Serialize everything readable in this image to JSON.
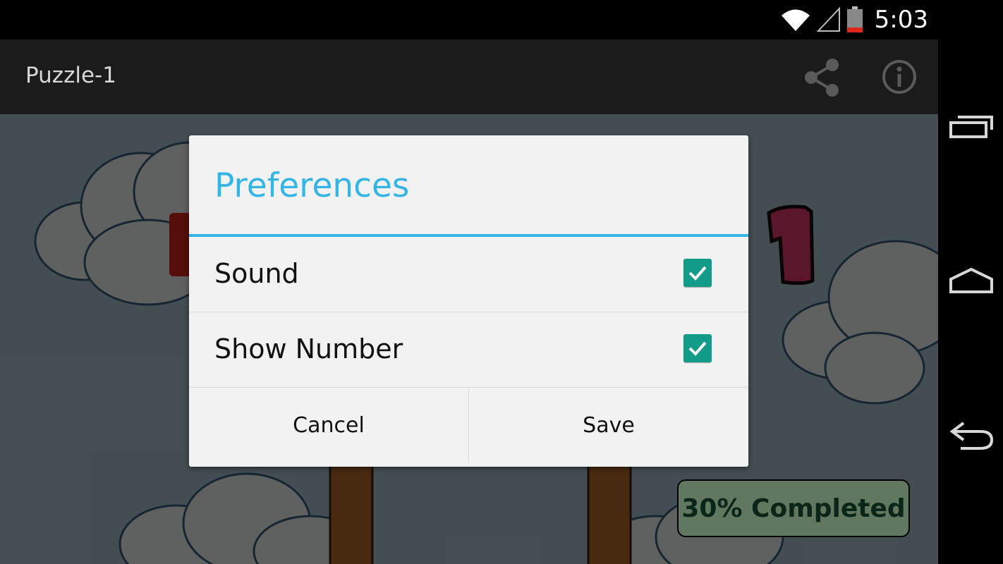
{
  "status_bar": {
    "time": "5:03",
    "icons": [
      "wifi-icon",
      "cell-signal-icon",
      "battery-icon"
    ]
  },
  "action_bar": {
    "title": "Puzzle-1",
    "actions": [
      "share-icon",
      "info-icon"
    ]
  },
  "dialog": {
    "title": "Preferences",
    "accent_color": "#33b5e5",
    "options": [
      {
        "label": "Sound",
        "checked": true
      },
      {
        "label": "Show Number",
        "checked": true
      }
    ],
    "buttons": {
      "cancel": "Cancel",
      "save": "Save"
    },
    "checkbox_color": "#119b88"
  },
  "game": {
    "progress_text": "30% Completed",
    "progress_fraction": 0.3,
    "puzzle_number": "1"
  },
  "nav_bar": {
    "buttons": [
      "recent-apps-icon",
      "home-icon",
      "back-icon"
    ]
  }
}
